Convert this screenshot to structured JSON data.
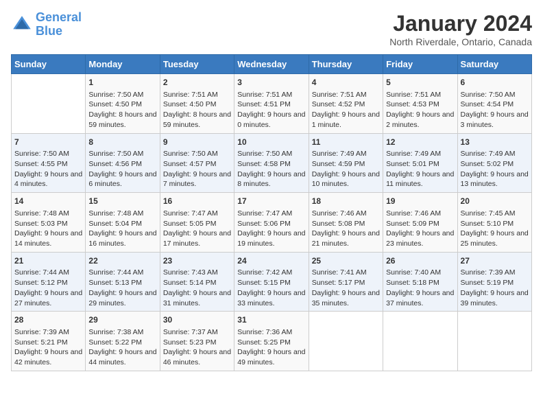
{
  "header": {
    "logo_line1": "General",
    "logo_line2": "Blue",
    "month": "January 2024",
    "location": "North Riverdale, Ontario, Canada"
  },
  "weekdays": [
    "Sunday",
    "Monday",
    "Tuesday",
    "Wednesday",
    "Thursday",
    "Friday",
    "Saturday"
  ],
  "weeks": [
    [
      {
        "day": "",
        "sunrise": "",
        "sunset": "",
        "daylight": ""
      },
      {
        "day": "1",
        "sunrise": "Sunrise: 7:50 AM",
        "sunset": "Sunset: 4:50 PM",
        "daylight": "Daylight: 8 hours and 59 minutes."
      },
      {
        "day": "2",
        "sunrise": "Sunrise: 7:51 AM",
        "sunset": "Sunset: 4:50 PM",
        "daylight": "Daylight: 8 hours and 59 minutes."
      },
      {
        "day": "3",
        "sunrise": "Sunrise: 7:51 AM",
        "sunset": "Sunset: 4:51 PM",
        "daylight": "Daylight: 9 hours and 0 minutes."
      },
      {
        "day": "4",
        "sunrise": "Sunrise: 7:51 AM",
        "sunset": "Sunset: 4:52 PM",
        "daylight": "Daylight: 9 hours and 1 minute."
      },
      {
        "day": "5",
        "sunrise": "Sunrise: 7:51 AM",
        "sunset": "Sunset: 4:53 PM",
        "daylight": "Daylight: 9 hours and 2 minutes."
      },
      {
        "day": "6",
        "sunrise": "Sunrise: 7:50 AM",
        "sunset": "Sunset: 4:54 PM",
        "daylight": "Daylight: 9 hours and 3 minutes."
      }
    ],
    [
      {
        "day": "7",
        "sunrise": "Sunrise: 7:50 AM",
        "sunset": "Sunset: 4:55 PM",
        "daylight": "Daylight: 9 hours and 4 minutes."
      },
      {
        "day": "8",
        "sunrise": "Sunrise: 7:50 AM",
        "sunset": "Sunset: 4:56 PM",
        "daylight": "Daylight: 9 hours and 6 minutes."
      },
      {
        "day": "9",
        "sunrise": "Sunrise: 7:50 AM",
        "sunset": "Sunset: 4:57 PM",
        "daylight": "Daylight: 9 hours and 7 minutes."
      },
      {
        "day": "10",
        "sunrise": "Sunrise: 7:50 AM",
        "sunset": "Sunset: 4:58 PM",
        "daylight": "Daylight: 9 hours and 8 minutes."
      },
      {
        "day": "11",
        "sunrise": "Sunrise: 7:49 AM",
        "sunset": "Sunset: 4:59 PM",
        "daylight": "Daylight: 9 hours and 10 minutes."
      },
      {
        "day": "12",
        "sunrise": "Sunrise: 7:49 AM",
        "sunset": "Sunset: 5:01 PM",
        "daylight": "Daylight: 9 hours and 11 minutes."
      },
      {
        "day": "13",
        "sunrise": "Sunrise: 7:49 AM",
        "sunset": "Sunset: 5:02 PM",
        "daylight": "Daylight: 9 hours and 13 minutes."
      }
    ],
    [
      {
        "day": "14",
        "sunrise": "Sunrise: 7:48 AM",
        "sunset": "Sunset: 5:03 PM",
        "daylight": "Daylight: 9 hours and 14 minutes."
      },
      {
        "day": "15",
        "sunrise": "Sunrise: 7:48 AM",
        "sunset": "Sunset: 5:04 PM",
        "daylight": "Daylight: 9 hours and 16 minutes."
      },
      {
        "day": "16",
        "sunrise": "Sunrise: 7:47 AM",
        "sunset": "Sunset: 5:05 PM",
        "daylight": "Daylight: 9 hours and 17 minutes."
      },
      {
        "day": "17",
        "sunrise": "Sunrise: 7:47 AM",
        "sunset": "Sunset: 5:06 PM",
        "daylight": "Daylight: 9 hours and 19 minutes."
      },
      {
        "day": "18",
        "sunrise": "Sunrise: 7:46 AM",
        "sunset": "Sunset: 5:08 PM",
        "daylight": "Daylight: 9 hours and 21 minutes."
      },
      {
        "day": "19",
        "sunrise": "Sunrise: 7:46 AM",
        "sunset": "Sunset: 5:09 PM",
        "daylight": "Daylight: 9 hours and 23 minutes."
      },
      {
        "day": "20",
        "sunrise": "Sunrise: 7:45 AM",
        "sunset": "Sunset: 5:10 PM",
        "daylight": "Daylight: 9 hours and 25 minutes."
      }
    ],
    [
      {
        "day": "21",
        "sunrise": "Sunrise: 7:44 AM",
        "sunset": "Sunset: 5:12 PM",
        "daylight": "Daylight: 9 hours and 27 minutes."
      },
      {
        "day": "22",
        "sunrise": "Sunrise: 7:44 AM",
        "sunset": "Sunset: 5:13 PM",
        "daylight": "Daylight: 9 hours and 29 minutes."
      },
      {
        "day": "23",
        "sunrise": "Sunrise: 7:43 AM",
        "sunset": "Sunset: 5:14 PM",
        "daylight": "Daylight: 9 hours and 31 minutes."
      },
      {
        "day": "24",
        "sunrise": "Sunrise: 7:42 AM",
        "sunset": "Sunset: 5:15 PM",
        "daylight": "Daylight: 9 hours and 33 minutes."
      },
      {
        "day": "25",
        "sunrise": "Sunrise: 7:41 AM",
        "sunset": "Sunset: 5:17 PM",
        "daylight": "Daylight: 9 hours and 35 minutes."
      },
      {
        "day": "26",
        "sunrise": "Sunrise: 7:40 AM",
        "sunset": "Sunset: 5:18 PM",
        "daylight": "Daylight: 9 hours and 37 minutes."
      },
      {
        "day": "27",
        "sunrise": "Sunrise: 7:39 AM",
        "sunset": "Sunset: 5:19 PM",
        "daylight": "Daylight: 9 hours and 39 minutes."
      }
    ],
    [
      {
        "day": "28",
        "sunrise": "Sunrise: 7:39 AM",
        "sunset": "Sunset: 5:21 PM",
        "daylight": "Daylight: 9 hours and 42 minutes."
      },
      {
        "day": "29",
        "sunrise": "Sunrise: 7:38 AM",
        "sunset": "Sunset: 5:22 PM",
        "daylight": "Daylight: 9 hours and 44 minutes."
      },
      {
        "day": "30",
        "sunrise": "Sunrise: 7:37 AM",
        "sunset": "Sunset: 5:23 PM",
        "daylight": "Daylight: 9 hours and 46 minutes."
      },
      {
        "day": "31",
        "sunrise": "Sunrise: 7:36 AM",
        "sunset": "Sunset: 5:25 PM",
        "daylight": "Daylight: 9 hours and 49 minutes."
      },
      {
        "day": "",
        "sunrise": "",
        "sunset": "",
        "daylight": ""
      },
      {
        "day": "",
        "sunrise": "",
        "sunset": "",
        "daylight": ""
      },
      {
        "day": "",
        "sunrise": "",
        "sunset": "",
        "daylight": ""
      }
    ]
  ]
}
